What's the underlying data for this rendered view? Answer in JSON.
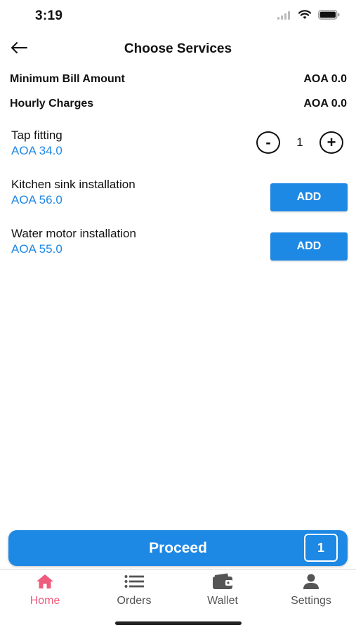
{
  "status_bar": {
    "time": "3:19"
  },
  "header": {
    "title": "Choose Services"
  },
  "bill": {
    "minimum_label": "Minimum Bill Amount",
    "minimum_value": "AOA 0.0",
    "hourly_label": "Hourly Charges",
    "hourly_value": "AOA 0.0"
  },
  "services": [
    {
      "name": "Tap fitting",
      "price": "AOA 34.0",
      "quantity": "1",
      "minus": "-",
      "plus": "+"
    },
    {
      "name": "Kitchen sink installation",
      "price": "AOA 56.0",
      "action": "ADD"
    },
    {
      "name": "Water motor installation",
      "price": "AOA 55.0",
      "action": "ADD"
    }
  ],
  "proceed": {
    "label": "Proceed",
    "count": "1"
  },
  "tabs": [
    {
      "label": "Home",
      "icon": "home-icon",
      "active": true
    },
    {
      "label": "Orders",
      "icon": "list-icon",
      "active": false
    },
    {
      "label": "Wallet",
      "icon": "wallet-icon",
      "active": false
    },
    {
      "label": "Settings",
      "icon": "person-icon",
      "active": false
    }
  ],
  "colors": {
    "accent": "#1e88e5",
    "active_tab": "#ef5b7d"
  }
}
